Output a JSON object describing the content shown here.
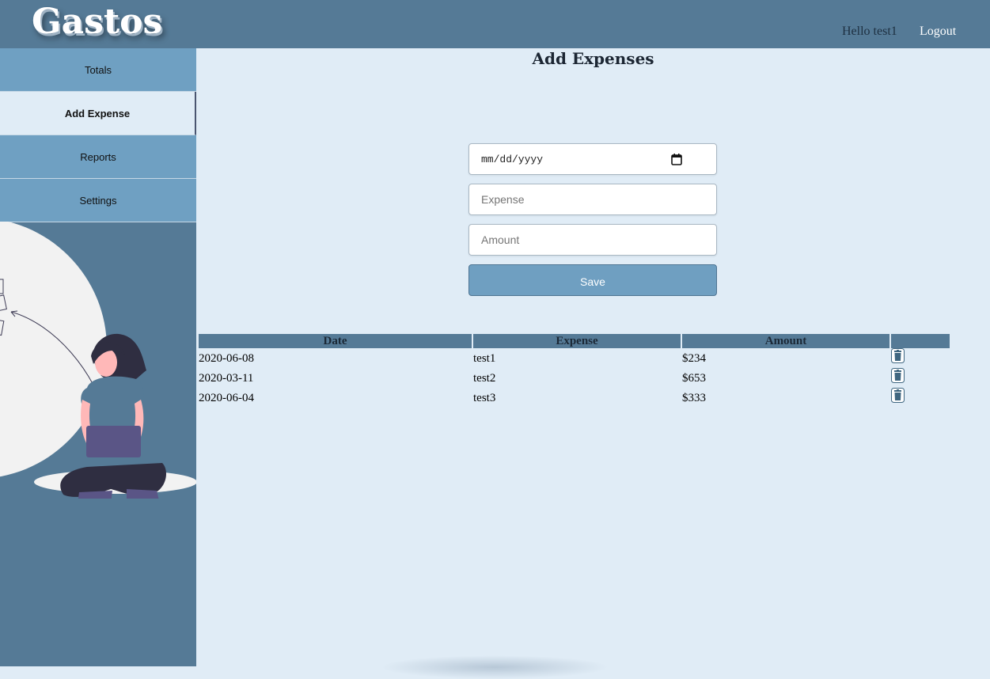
{
  "app": {
    "brand": "Gastos",
    "greeting": "Hello test1",
    "logout_label": "Logout"
  },
  "sidebar": {
    "items": [
      {
        "label": "Totals",
        "active": false
      },
      {
        "label": "Add Expense",
        "active": true
      },
      {
        "label": "Reports",
        "active": false
      },
      {
        "label": "Settings",
        "active": false
      }
    ]
  },
  "form": {
    "title": "Add Expenses",
    "date_placeholder": "mm/dd/yyyy",
    "expense_placeholder": "Expense",
    "amount_placeholder": "Amount",
    "save_label": "Save"
  },
  "table": {
    "headers": [
      "Date",
      "Expense",
      "Amount",
      ""
    ],
    "rows": [
      {
        "date": "2020-06-08",
        "expense": "test1",
        "amount": "$234"
      },
      {
        "date": "2020-03-11",
        "expense": "test2",
        "amount": "$653"
      },
      {
        "date": "2020-06-04",
        "expense": "test3",
        "amount": "$333"
      }
    ]
  },
  "colors": {
    "header_bg": "#557a96",
    "nav_bg": "#6fa0c2",
    "content_bg": "#e0ecf6",
    "save_bg": "#6f9fc1"
  }
}
